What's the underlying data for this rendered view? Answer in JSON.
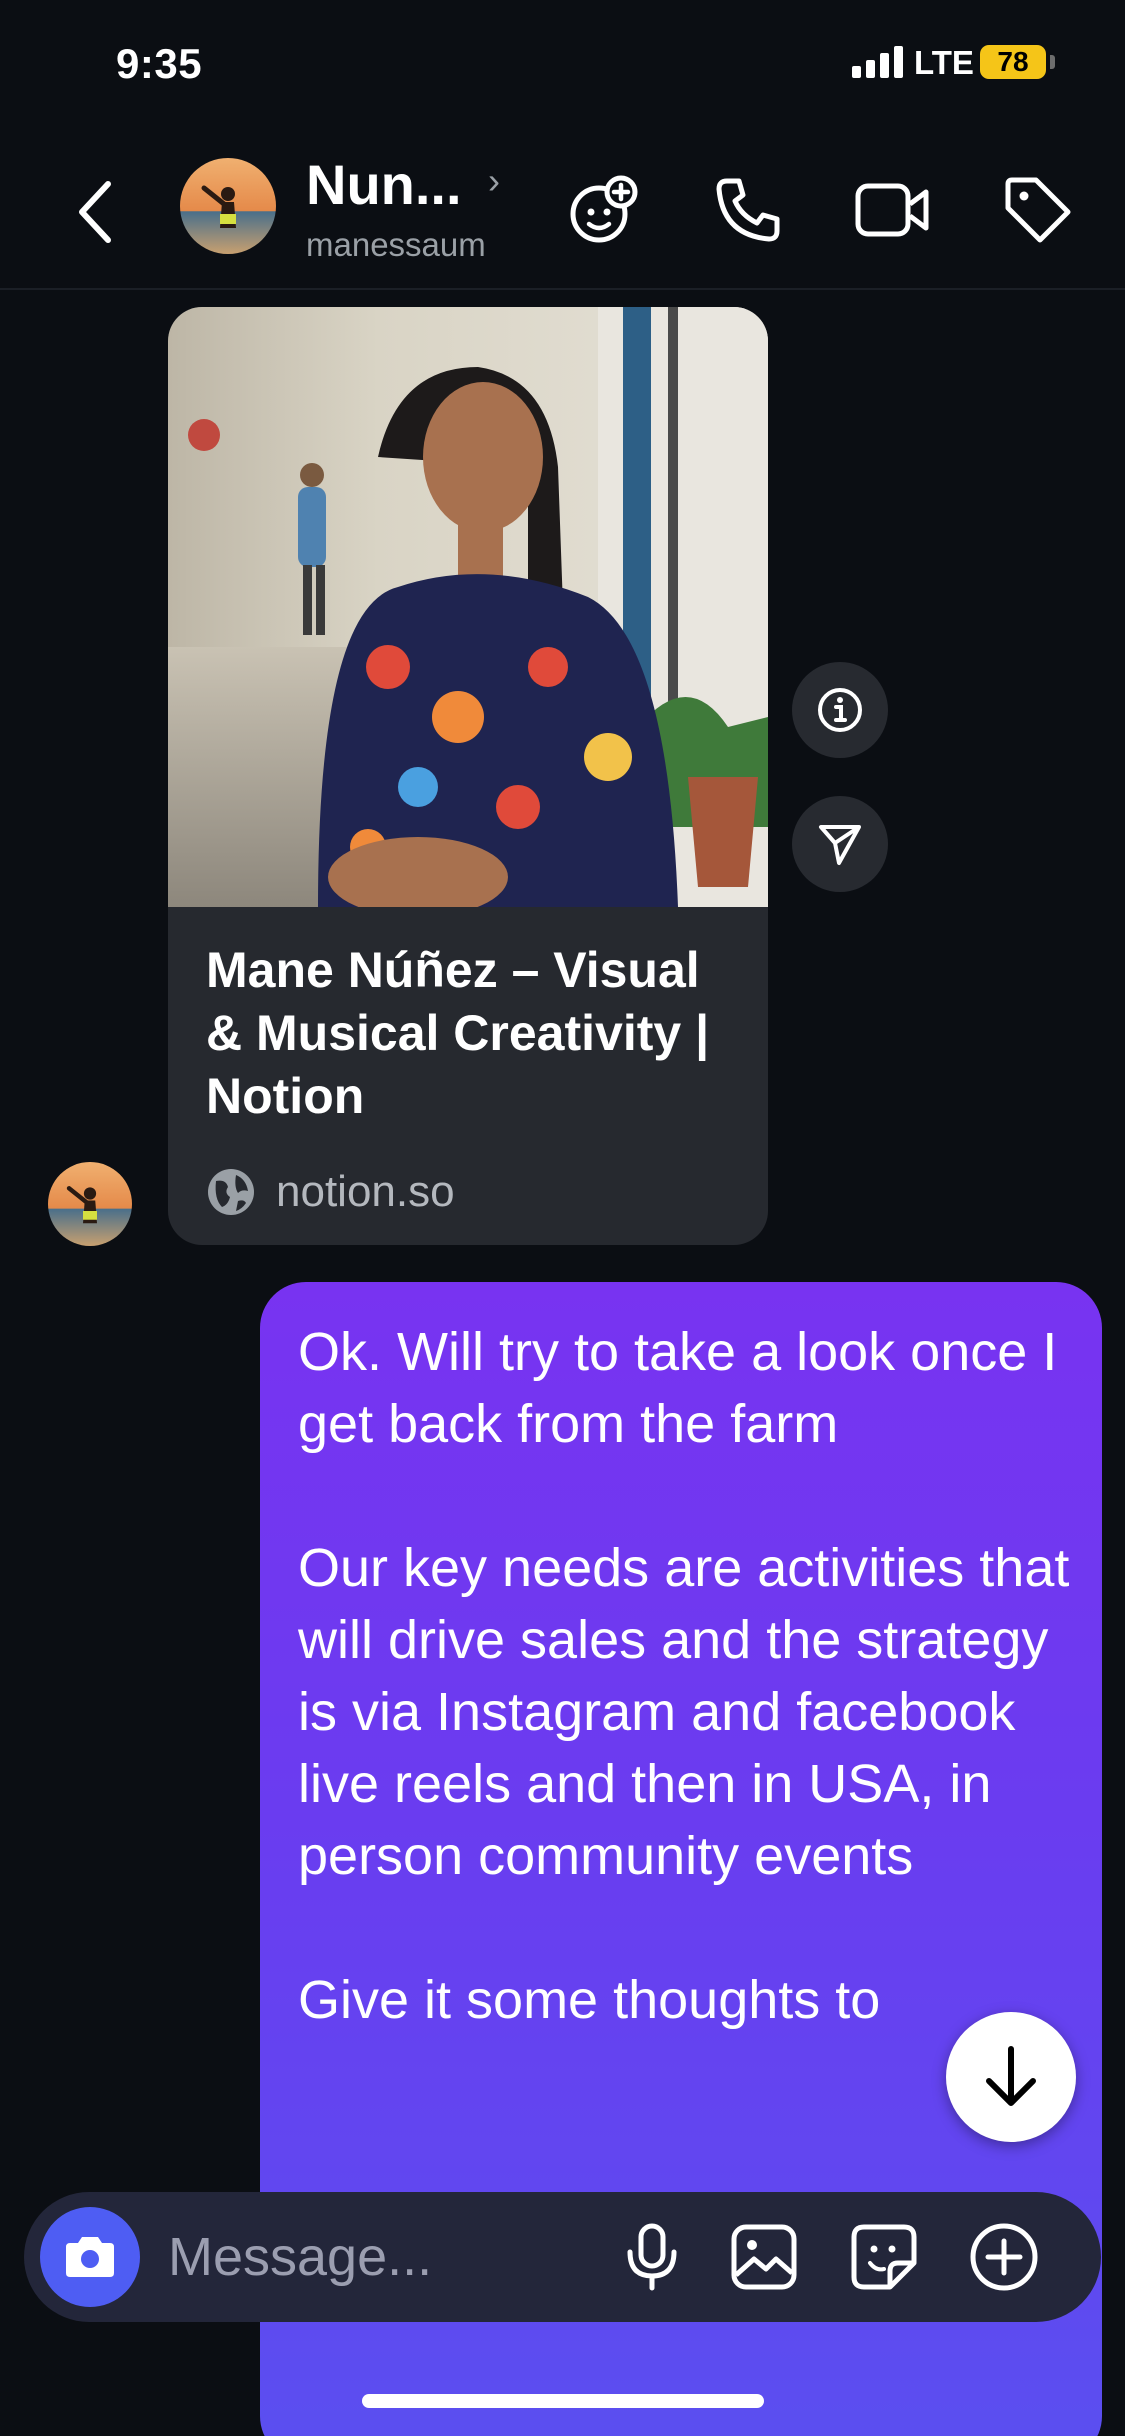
{
  "status_bar": {
    "time": "9:35",
    "network": "LTE",
    "battery": "78"
  },
  "header": {
    "contact_name": "Nun...",
    "username": "manessaum",
    "icons": [
      "back-icon",
      "effects-icon",
      "phone-icon",
      "video-icon",
      "tag-icon"
    ]
  },
  "link_preview": {
    "title": "Mane Núñez – Visual & Musical Creativity | Notion",
    "domain": "notion.so"
  },
  "outgoing_message": {
    "paragraphs": [
      "Ok. Will try to take a look once I get back from the farm",
      "Our key needs are activities that will drive sales and the strategy is via Instagram and facebook live reels and then in USA, in person community events",
      "Give it some thoughts to"
    ]
  },
  "composer": {
    "placeholder": "Message..."
  },
  "colors": {
    "background": "#0b0e13",
    "bubble_top": "#7833f1",
    "bubble_bottom": "#5a4ff0",
    "camera_button": "#4e5df3",
    "battery": "#f5c518"
  }
}
